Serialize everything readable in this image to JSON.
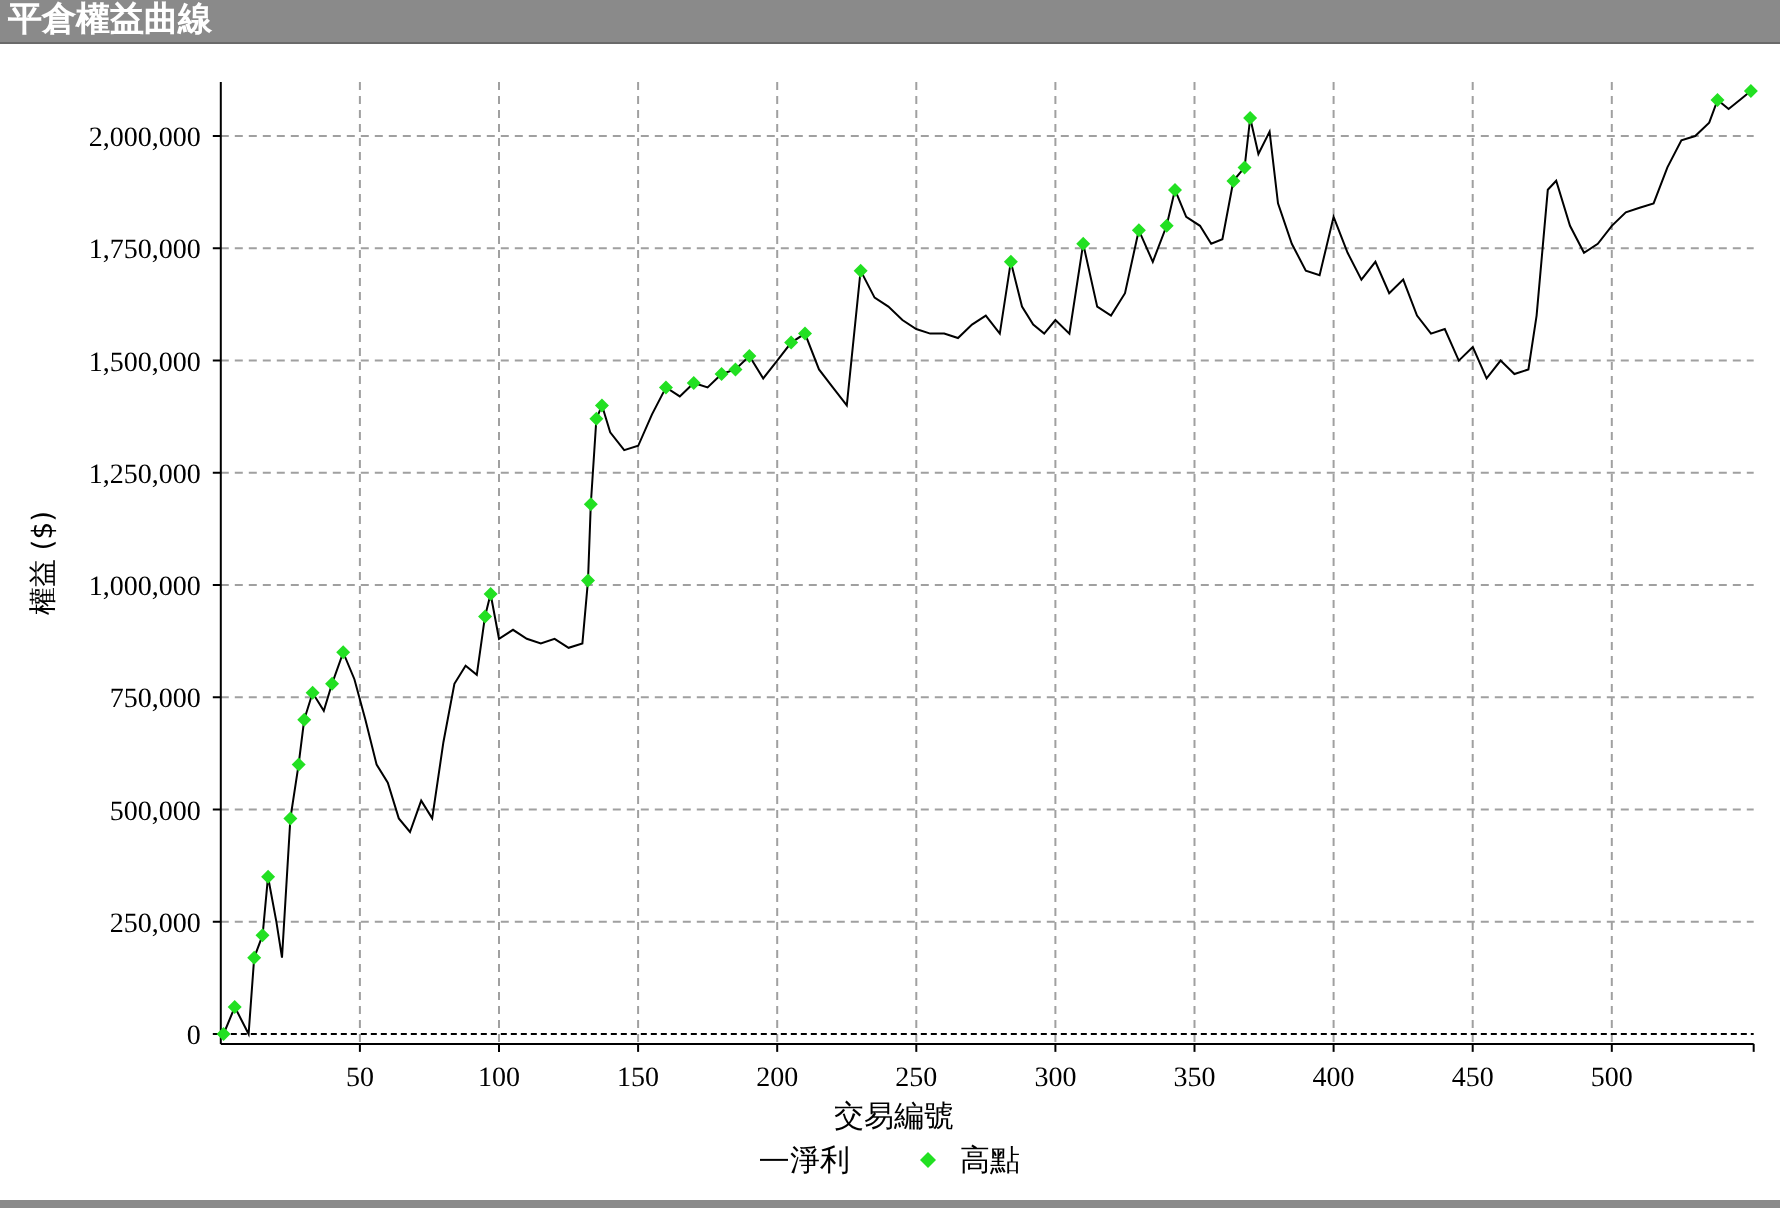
{
  "header": {
    "title": "平倉權益曲線"
  },
  "chart_data": {
    "type": "line",
    "xlabel": "交易編號",
    "ylabel": "權益 ($)",
    "grid": true,
    "ref_lines": [
      {
        "axis": "y",
        "value": 0
      }
    ],
    "legend": "bottom",
    "xlim": [
      0,
      551
    ],
    "ylim": [
      -22000,
      2120000
    ],
    "xticks": [
      50,
      100,
      150,
      200,
      250,
      300,
      350,
      400,
      450,
      500
    ],
    "yticks": [
      {
        "value": 0,
        "label": "0"
      },
      {
        "value": 250000,
        "label": "250,000"
      },
      {
        "value": 500000,
        "label": "500,000"
      },
      {
        "value": 750000,
        "label": "750,000"
      },
      {
        "value": 1000000,
        "label": "1,000,000"
      },
      {
        "value": 1250000,
        "label": "1,250,000"
      },
      {
        "value": 1500000,
        "label": "1,500,000"
      },
      {
        "value": 1750000,
        "label": "1,750,000"
      },
      {
        "value": 2000000,
        "label": "2,000,000"
      }
    ],
    "x": [
      1,
      5,
      10,
      12,
      15,
      17,
      20,
      22,
      25,
      28,
      30,
      33,
      37,
      40,
      44,
      48,
      52,
      56,
      60,
      64,
      68,
      72,
      76,
      80,
      84,
      88,
      92,
      95,
      97,
      100,
      105,
      110,
      115,
      120,
      125,
      130,
      132,
      133,
      135,
      137,
      140,
      145,
      150,
      155,
      160,
      165,
      170,
      175,
      180,
      185,
      190,
      195,
      200,
      205,
      210,
      215,
      220,
      225,
      230,
      235,
      240,
      245,
      250,
      255,
      260,
      265,
      270,
      275,
      280,
      284,
      288,
      292,
      296,
      300,
      305,
      310,
      315,
      320,
      325,
      330,
      335,
      340,
      343,
      347,
      352,
      356,
      360,
      364,
      368,
      370,
      373,
      377,
      380,
      385,
      390,
      395,
      400,
      405,
      410,
      415,
      420,
      425,
      430,
      435,
      440,
      445,
      450,
      455,
      460,
      465,
      470,
      473,
      477,
      480,
      485,
      490,
      495,
      500,
      505,
      510,
      515,
      520,
      525,
      530,
      535,
      538,
      542,
      546,
      550
    ],
    "series": [
      {
        "name": "淨利",
        "type": "line",
        "color": "#000000",
        "values": [
          0,
          60000,
          0,
          170000,
          220000,
          350000,
          250000,
          170000,
          480000,
          600000,
          700000,
          760000,
          720000,
          780000,
          850000,
          790000,
          700000,
          600000,
          560000,
          480000,
          450000,
          520000,
          480000,
          650000,
          780000,
          820000,
          800000,
          930000,
          980000,
          880000,
          900000,
          880000,
          870000,
          880000,
          860000,
          870000,
          1010000,
          1180000,
          1370000,
          1400000,
          1340000,
          1300000,
          1310000,
          1380000,
          1440000,
          1420000,
          1450000,
          1440000,
          1470000,
          1480000,
          1510000,
          1460000,
          1500000,
          1540000,
          1560000,
          1480000,
          1440000,
          1400000,
          1700000,
          1640000,
          1620000,
          1590000,
          1570000,
          1560000,
          1560000,
          1550000,
          1580000,
          1600000,
          1560000,
          1720000,
          1620000,
          1580000,
          1560000,
          1590000,
          1560000,
          1760000,
          1620000,
          1600000,
          1650000,
          1790000,
          1720000,
          1800000,
          1880000,
          1820000,
          1800000,
          1760000,
          1770000,
          1900000,
          1930000,
          2040000,
          1960000,
          2010000,
          1850000,
          1760000,
          1700000,
          1690000,
          1820000,
          1740000,
          1680000,
          1720000,
          1650000,
          1680000,
          1600000,
          1560000,
          1570000,
          1500000,
          1530000,
          1460000,
          1500000,
          1470000,
          1480000,
          1600000,
          1880000,
          1900000,
          1800000,
          1740000,
          1760000,
          1800000,
          1830000,
          1840000,
          1850000,
          1930000,
          1990000,
          2000000,
          2030000,
          2080000,
          2060000,
          2080000,
          2100000
        ]
      },
      {
        "name": "高點",
        "type": "scatter",
        "color": "#22e022",
        "values": [
          0,
          60000,
          null,
          170000,
          220000,
          350000,
          null,
          null,
          480000,
          600000,
          700000,
          760000,
          null,
          780000,
          850000,
          null,
          null,
          null,
          null,
          null,
          null,
          null,
          null,
          null,
          null,
          null,
          null,
          930000,
          980000,
          null,
          null,
          null,
          null,
          null,
          null,
          null,
          1010000,
          1180000,
          1370000,
          1400000,
          null,
          null,
          null,
          null,
          1440000,
          null,
          1450000,
          null,
          1470000,
          1480000,
          1510000,
          null,
          null,
          1540000,
          1560000,
          null,
          null,
          null,
          1700000,
          null,
          null,
          null,
          null,
          null,
          null,
          null,
          null,
          null,
          null,
          1720000,
          null,
          null,
          null,
          null,
          null,
          1760000,
          null,
          null,
          null,
          1790000,
          null,
          1800000,
          1880000,
          null,
          null,
          null,
          null,
          1900000,
          1930000,
          2040000,
          null,
          null,
          null,
          null,
          null,
          null,
          null,
          null,
          null,
          null,
          null,
          null,
          null,
          null,
          null,
          null,
          null,
          null,
          null,
          null,
          null,
          null,
          null,
          null,
          null,
          null,
          null,
          null,
          null,
          null,
          null,
          null,
          null,
          null,
          null,
          2080000,
          null,
          null,
          2100000
        ]
      }
    ]
  }
}
